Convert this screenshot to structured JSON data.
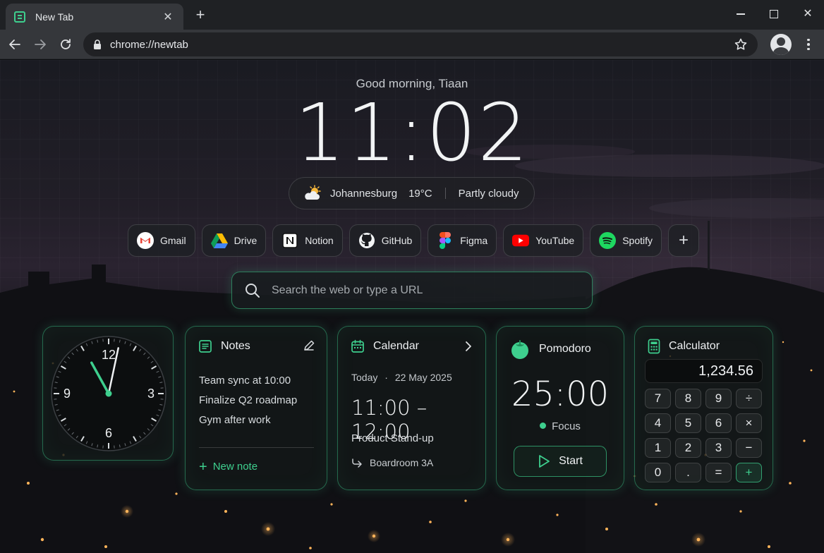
{
  "browser": {
    "tab_title": "New Tab",
    "url": "chrome://newtab"
  },
  "page": {
    "greeting": "Good morning, Tiaan",
    "time": "11:02",
    "weather": {
      "city": "Johannesburg",
      "temp": "19°C",
      "condition": "Partly cloudy",
      "icon": "partly-cloudy-icon"
    },
    "shortcuts": [
      {
        "label": "Gmail",
        "icon": "gmail-icon"
      },
      {
        "label": "Drive",
        "icon": "drive-icon"
      },
      {
        "label": "Notion",
        "icon": "notion-icon"
      },
      {
        "label": "GitHub",
        "icon": "github-icon"
      },
      {
        "label": "Figma",
        "icon": "figma-icon"
      },
      {
        "label": "YouTube",
        "icon": "youtube-icon"
      },
      {
        "label": "Spotify",
        "icon": "spotify-icon"
      }
    ],
    "search": {
      "placeholder": "Search the web or type a URL"
    }
  },
  "widgets": {
    "clock": {
      "numbers": {
        "n12": "12",
        "n3": "3",
        "n6": "6",
        "n9": "9"
      },
      "hours": 11,
      "minutes": 2
    },
    "notes": {
      "title": "Notes",
      "items": [
        "Team sync at 10:00",
        "Finalize Q2 roadmap",
        "Gym after work"
      ],
      "new_note": "New note"
    },
    "calendar": {
      "title": "Calendar",
      "day": "Today",
      "date": "22 May 2025",
      "time_range": "11:00 – 12:00",
      "event": "Product Stand-up",
      "room": "Boardroom 3A"
    },
    "pomodoro": {
      "title": "Pomodoro",
      "time": "25:00",
      "status": "Focus",
      "start": "Start"
    },
    "calculator": {
      "title": "Calculator",
      "display": "1,234.56",
      "keys": [
        "7",
        "8",
        "9",
        "÷",
        "4",
        "5",
        "6",
        "×",
        "1",
        "2",
        "3",
        "−",
        "0",
        ".",
        "=",
        "+"
      ]
    }
  },
  "colors": {
    "accent": "#3ecf8e",
    "chrome_bg": "#35373b",
    "tabbar_bg": "#1f2124"
  }
}
